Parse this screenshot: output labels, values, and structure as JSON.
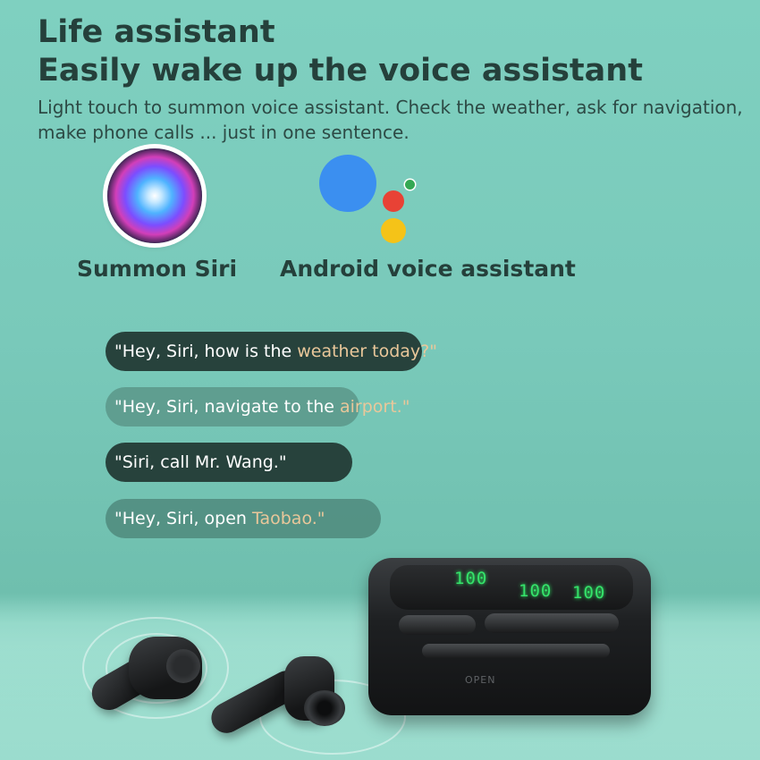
{
  "heading": {
    "line1": "Life assistant",
    "line2": "Easily wake up the voice assistant"
  },
  "description": "Light touch to summon voice assistant. Check the weather, ask for navigation, make phone calls ... just in one sentence.",
  "assistants": [
    {
      "label": "Summon Siri",
      "icon": "siri-icon"
    },
    {
      "label": "Android voice assistant",
      "icon": "google-assistant-icon"
    }
  ],
  "phrases": [
    {
      "text_a": "\"Hey, Siri, how is the ",
      "text_b": "weather today?\""
    },
    {
      "text_a": "\"Hey, Siri, navigate to the ",
      "text_b": "airport.\""
    },
    {
      "text_a": "\"Siri, call Mr. Wang.\"",
      "text_b": ""
    },
    {
      "text_a": "\"Hey, Siri, open ",
      "text_b": "Taobao.\""
    }
  ],
  "case": {
    "led_left": "100",
    "led_mid": "100",
    "led_right": "100",
    "open_label": "OPEN"
  },
  "colors": {
    "google_blue": "#3b8ff0",
    "google_red": "#e84235",
    "google_yellow": "#f5c318",
    "google_green": "#34a853",
    "led_green": "#35e36a"
  }
}
